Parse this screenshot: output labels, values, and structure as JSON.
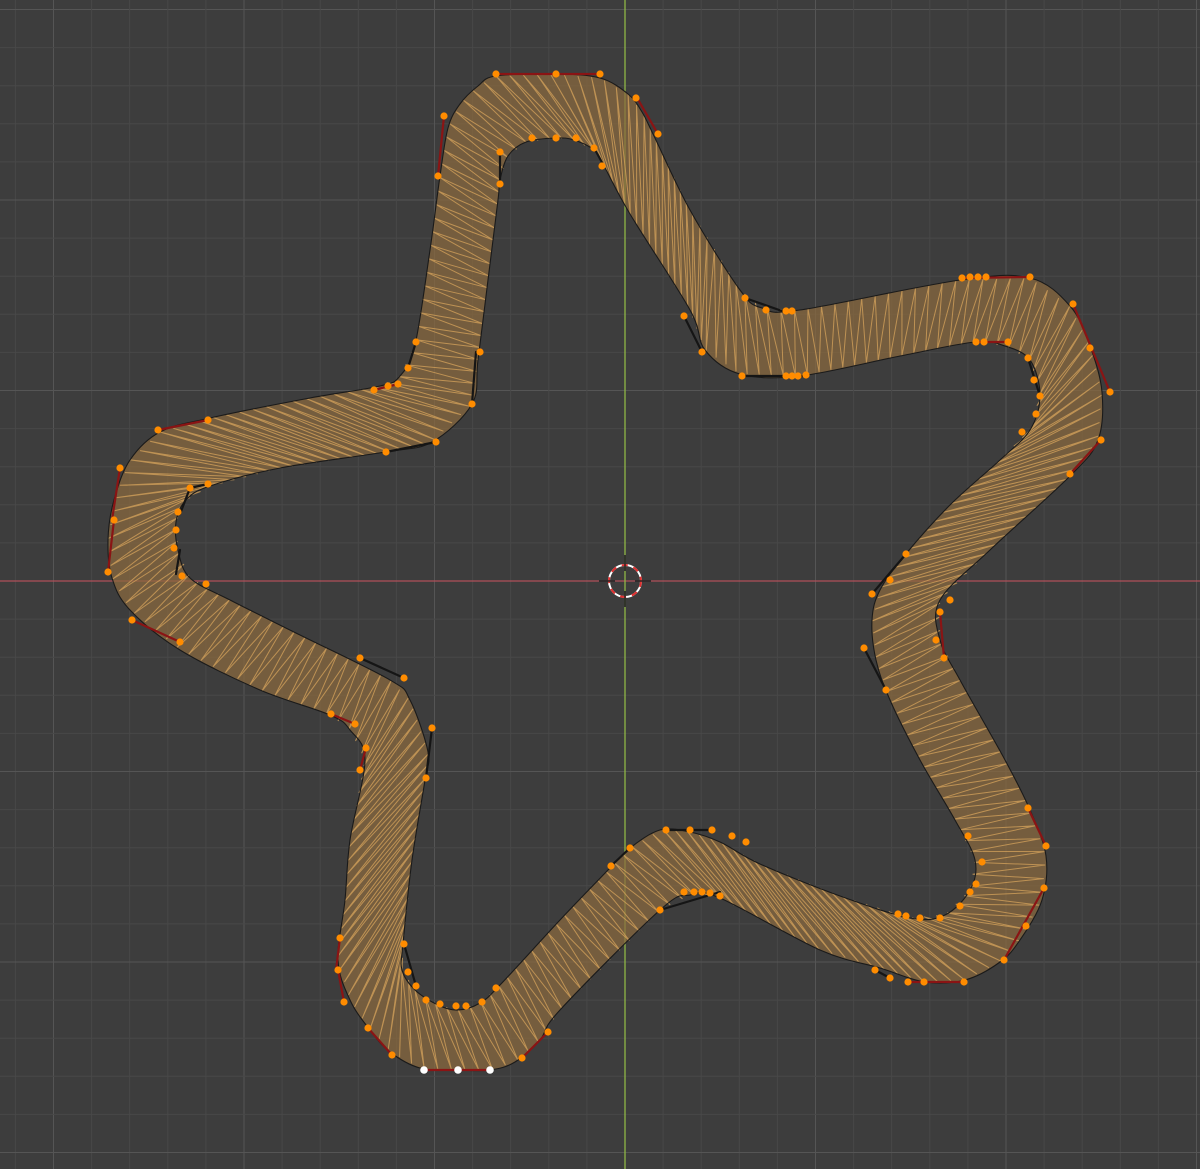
{
  "viewport": {
    "type": "blender-3d-viewport",
    "view": "top-orthographic",
    "object": "curve-star-ribbon",
    "mode": "edit-mode",
    "colors": {
      "background": "#3d3d3d",
      "grid_minor": "#484848",
      "grid_major": "#555555",
      "axis_x": "#b0505a",
      "axis_y": "#8fb646",
      "ribbon_fill": "#8a6a3f",
      "zigzag": "#d7a45c",
      "outline": "#1a1a1a",
      "handle_selected": "#8a1414",
      "handle_unselected": "#151515",
      "vertex_selected": "#ff8c00",
      "vertex_active": "#ffffff",
      "cursor_red": "#e03030",
      "cursor_white": "#ffffff"
    },
    "icons": {
      "cursor": "3d-cursor-icon"
    }
  }
}
